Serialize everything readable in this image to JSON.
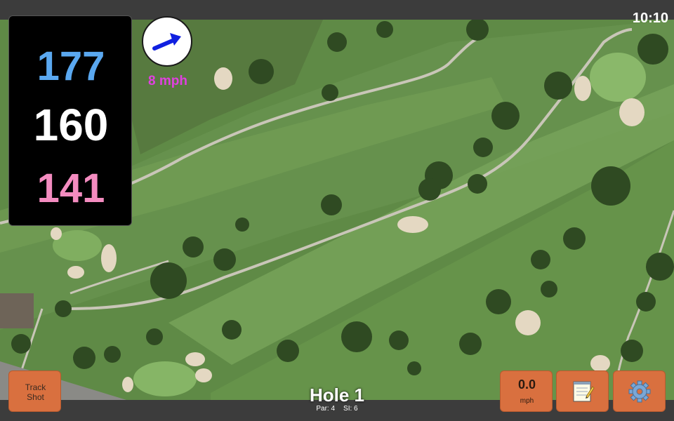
{
  "status": {
    "time": "10:10"
  },
  "distances": {
    "back": "177",
    "middle": "160",
    "front": "141",
    "colors": {
      "back": "#5aa8f0",
      "middle": "#ffffff",
      "front": "#f48cc0"
    }
  },
  "wind": {
    "speed_label": "8 mph",
    "label_color": "#e040e0",
    "arrow_color": "#1020e0",
    "direction_icon": "wind-arrow-icon"
  },
  "hole": {
    "title": "Hole 1",
    "par": "Par: 4",
    "si": "SI: 6"
  },
  "buttons": {
    "track_shot": [
      "Track",
      "Shot"
    ],
    "speed_value": "0.0",
    "speed_unit": "mph",
    "notes_icon": "notepad-icon",
    "settings_icon": "gear-icon",
    "accent": "#d9703f"
  },
  "map": {
    "type": "aerial-satellite-golf-course"
  }
}
